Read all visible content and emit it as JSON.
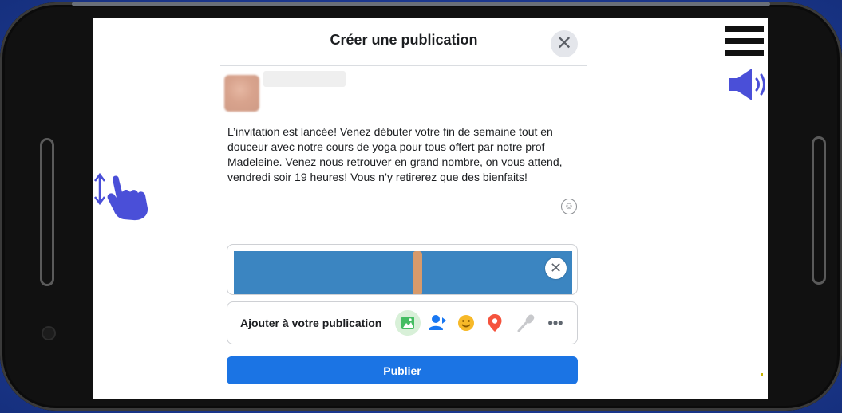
{
  "dialog": {
    "title": "Créer une publication",
    "close_symbol": "✕"
  },
  "post": {
    "text": "L’invitation est lancée! Venez débuter votre fin de semaine tout en douceur avec notre cours de yoga pour tous offert par notre prof Madeleine. Venez nous retrouver en grand nombre, on vous attend, vendredi soir 19 heures! Vous n’y retirerez que des bienfaits!"
  },
  "add_to_post": {
    "label": "Ajouter à votre publication",
    "icons": [
      "photo-icon",
      "tag-people-icon",
      "feeling-icon",
      "location-icon",
      "microphone-icon",
      "more-icon"
    ]
  },
  "publish": {
    "label": "Publier"
  },
  "overlay_icons": [
    "menu-icon",
    "speaker-icon",
    "scroll-gesture-icon"
  ],
  "colors": {
    "primary": "#1b74e4",
    "background": "#1f3f9c",
    "overlay_icon": "#4a4fd8"
  }
}
